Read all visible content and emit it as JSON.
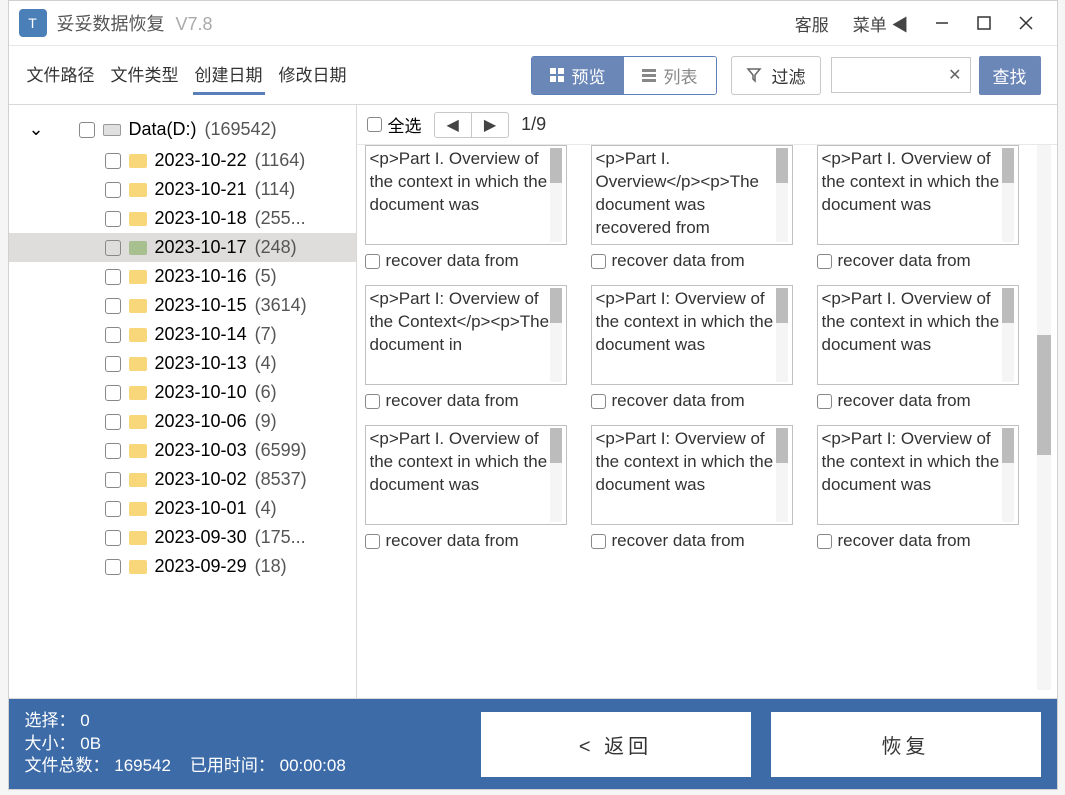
{
  "titlebar": {
    "app_name": "妥妥数据恢复",
    "version": "V7.8",
    "customer_service": "客服",
    "menu": "菜单"
  },
  "tabs": {
    "file_path": "文件路径",
    "file_type": "文件类型",
    "create_date": "创建日期",
    "modify_date": "修改日期"
  },
  "view": {
    "preview": "预览",
    "list": "列表",
    "filter": "过滤",
    "search": "查找"
  },
  "content_header": {
    "select_all": "全选",
    "page": "1/9"
  },
  "tree": {
    "root_label": "Data(D:)",
    "root_count": "(169542)",
    "items": [
      {
        "label": "2023-10-22",
        "count": "(1164)"
      },
      {
        "label": "2023-10-21",
        "count": "(114)"
      },
      {
        "label": "2023-10-18",
        "count": "(255..."
      },
      {
        "label": "2023-10-17",
        "count": "(248)",
        "selected": true
      },
      {
        "label": "2023-10-16",
        "count": "(5)"
      },
      {
        "label": "2023-10-15",
        "count": "(3614)"
      },
      {
        "label": "2023-10-14",
        "count": "(7)"
      },
      {
        "label": "2023-10-13",
        "count": "(4)"
      },
      {
        "label": "2023-10-10",
        "count": "(6)"
      },
      {
        "label": "2023-10-06",
        "count": "(9)"
      },
      {
        "label": "2023-10-03",
        "count": "(6599)"
      },
      {
        "label": "2023-10-02",
        "count": "(8537)"
      },
      {
        "label": "2023-10-01",
        "count": "(4)"
      },
      {
        "label": "2023-09-30",
        "count": "(175..."
      },
      {
        "label": "2023-09-29",
        "count": "(18)"
      }
    ]
  },
  "thumbs": [
    {
      "text": "<p>Part I. Overview of the context in which the document was",
      "caption": "recover data from"
    },
    {
      "text": "<p>Part I. Overview</p><p>The document was recovered from",
      "caption": "recover data from"
    },
    {
      "text": "<p>Part I. Overview of the context in which the document was",
      "caption": "recover data from"
    },
    {
      "text": "<p>Part I: Overview of the Context</p><p>The document in",
      "caption": "recover data from"
    },
    {
      "text": "<p>Part I: Overview of the context in which the document was",
      "caption": "recover data from"
    },
    {
      "text": "<p>Part I. Overview of the context in which the document was",
      "caption": "recover data from"
    },
    {
      "text": "<p>Part I. Overview of the context in which the document was",
      "caption": "recover data from"
    },
    {
      "text": "<p>Part I: Overview of the context in which the document was",
      "caption": "recover data from"
    },
    {
      "text": "<p>Part I: Overview of the context in which the document was",
      "caption": "recover data from"
    }
  ],
  "footer": {
    "selected_label": "选择：",
    "selected_value": "0",
    "size_label": "大小：",
    "size_value": "0B",
    "total_label": "文件总数：",
    "total_value": "169542",
    "elapsed_label": "已用时间：",
    "elapsed_value": "00:00:08",
    "back": "< 返回",
    "recover": "恢复"
  }
}
